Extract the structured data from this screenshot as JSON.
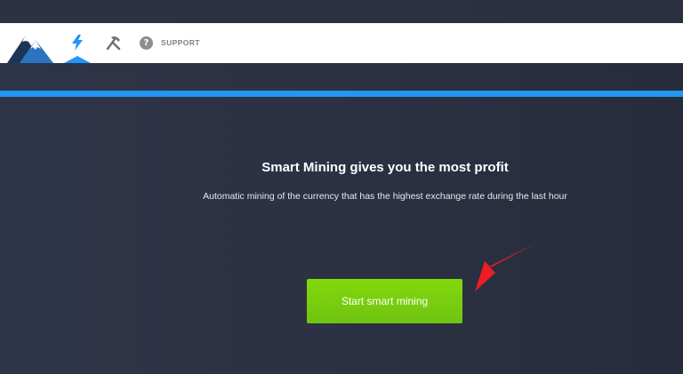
{
  "header": {
    "support_label": "SUPPORT",
    "icons": [
      "mountain-logo",
      "lightning-icon",
      "tools-icon",
      "help-icon"
    ]
  },
  "main": {
    "title": "Smart Mining gives you the most profit",
    "subtitle": "Automatic mining of the currency that has the highest exchange rate during the last hour",
    "start_button_label": "Start smart mining"
  },
  "colors": {
    "background": "#2b3142",
    "header": "#ffffff",
    "accent_blue": "#2196f3",
    "button_green": "#7acc10",
    "arrow_red": "#ee1c25"
  }
}
